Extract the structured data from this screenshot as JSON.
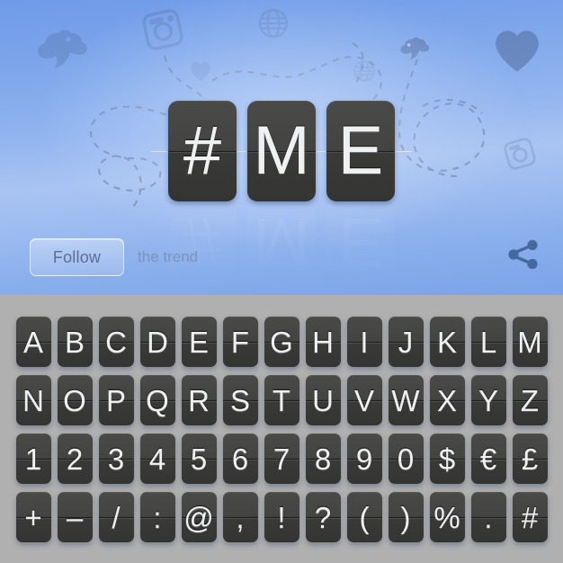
{
  "banner": {
    "hero_tiles": [
      "#",
      "M",
      "E"
    ],
    "follow_label": "Follow",
    "trend_label": "the trend",
    "share_icon_name": "share-icon",
    "decorations": [
      {
        "name": "twitter-bird-icon",
        "label": "twitter bird"
      },
      {
        "name": "instagram-camera-icon",
        "label": "instagram camera"
      },
      {
        "name": "globe-icon",
        "label": "globe"
      },
      {
        "name": "heart-icon",
        "label": "heart"
      },
      {
        "name": "dashed-trail-path",
        "label": "dashed trail"
      }
    ]
  },
  "keyboard": {
    "rows": [
      [
        "A",
        "B",
        "C",
        "D",
        "E",
        "F",
        "G",
        "H",
        "I",
        "J",
        "K",
        "L",
        "M"
      ],
      [
        "N",
        "O",
        "P",
        "Q",
        "R",
        "S",
        "T",
        "U",
        "V",
        "W",
        "X",
        "Y",
        "Z"
      ],
      [
        "1",
        "2",
        "3",
        "4",
        "5",
        "6",
        "7",
        "8",
        "9",
        "0",
        "$",
        "€",
        "£"
      ],
      [
        "+",
        "–",
        "/",
        ":",
        "@",
        ",",
        "!",
        "?",
        "(",
        ")",
        "%",
        ".",
        "#"
      ]
    ]
  },
  "colors": {
    "banner_top": "#6f9ae8",
    "banner_mid": "#a9c4f2",
    "tile_dark": "#434341",
    "tile_text": "#eef0f2",
    "keyboard_bg": "#b0b0b0",
    "follow_text": "#5b6f96",
    "trend_text": "#7c93bd",
    "share_icon": "#4a6ea8"
  }
}
